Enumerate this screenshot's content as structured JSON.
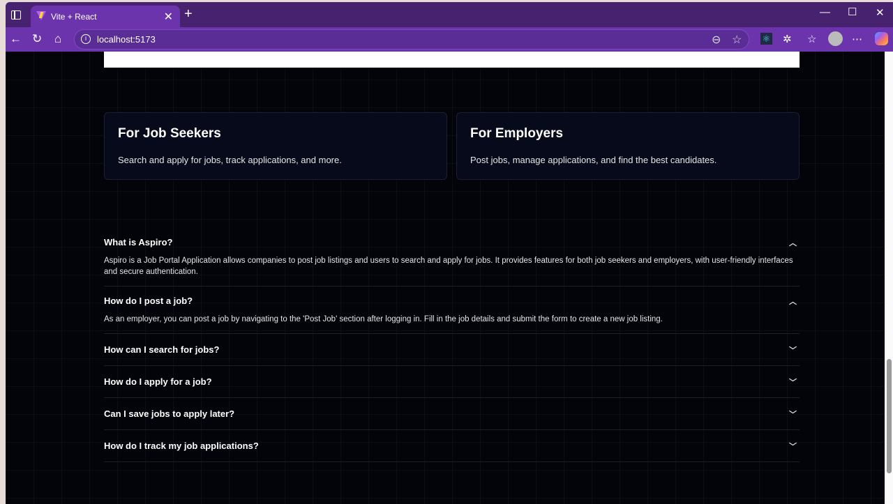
{
  "browser": {
    "tab_title": "Vite + React",
    "url": "localhost:5173"
  },
  "cards": [
    {
      "title": "For Job Seekers",
      "text": "Search and apply for jobs, track applications, and more."
    },
    {
      "title": "For Employers",
      "text": "Post jobs, manage applications, and find the best candidates."
    }
  ],
  "faq": [
    {
      "q": "What is Aspiro?",
      "a": "Aspiro is a Job Portal Application allows companies to post job listings and users to search and apply for jobs. It provides features for both job seekers and employers, with user-friendly interfaces and secure authentication.",
      "open": true
    },
    {
      "q": "How do I post a job?",
      "a": "As an employer, you can post a job by navigating to the 'Post Job' section after logging in. Fill in the job details and submit the form to create a new job listing.",
      "open": true
    },
    {
      "q": "How can I search for jobs?",
      "open": false
    },
    {
      "q": "How do I apply for a job?",
      "open": false
    },
    {
      "q": "Can I save jobs to apply later?",
      "open": false
    },
    {
      "q": "How do I track my job applications?",
      "open": false
    }
  ]
}
